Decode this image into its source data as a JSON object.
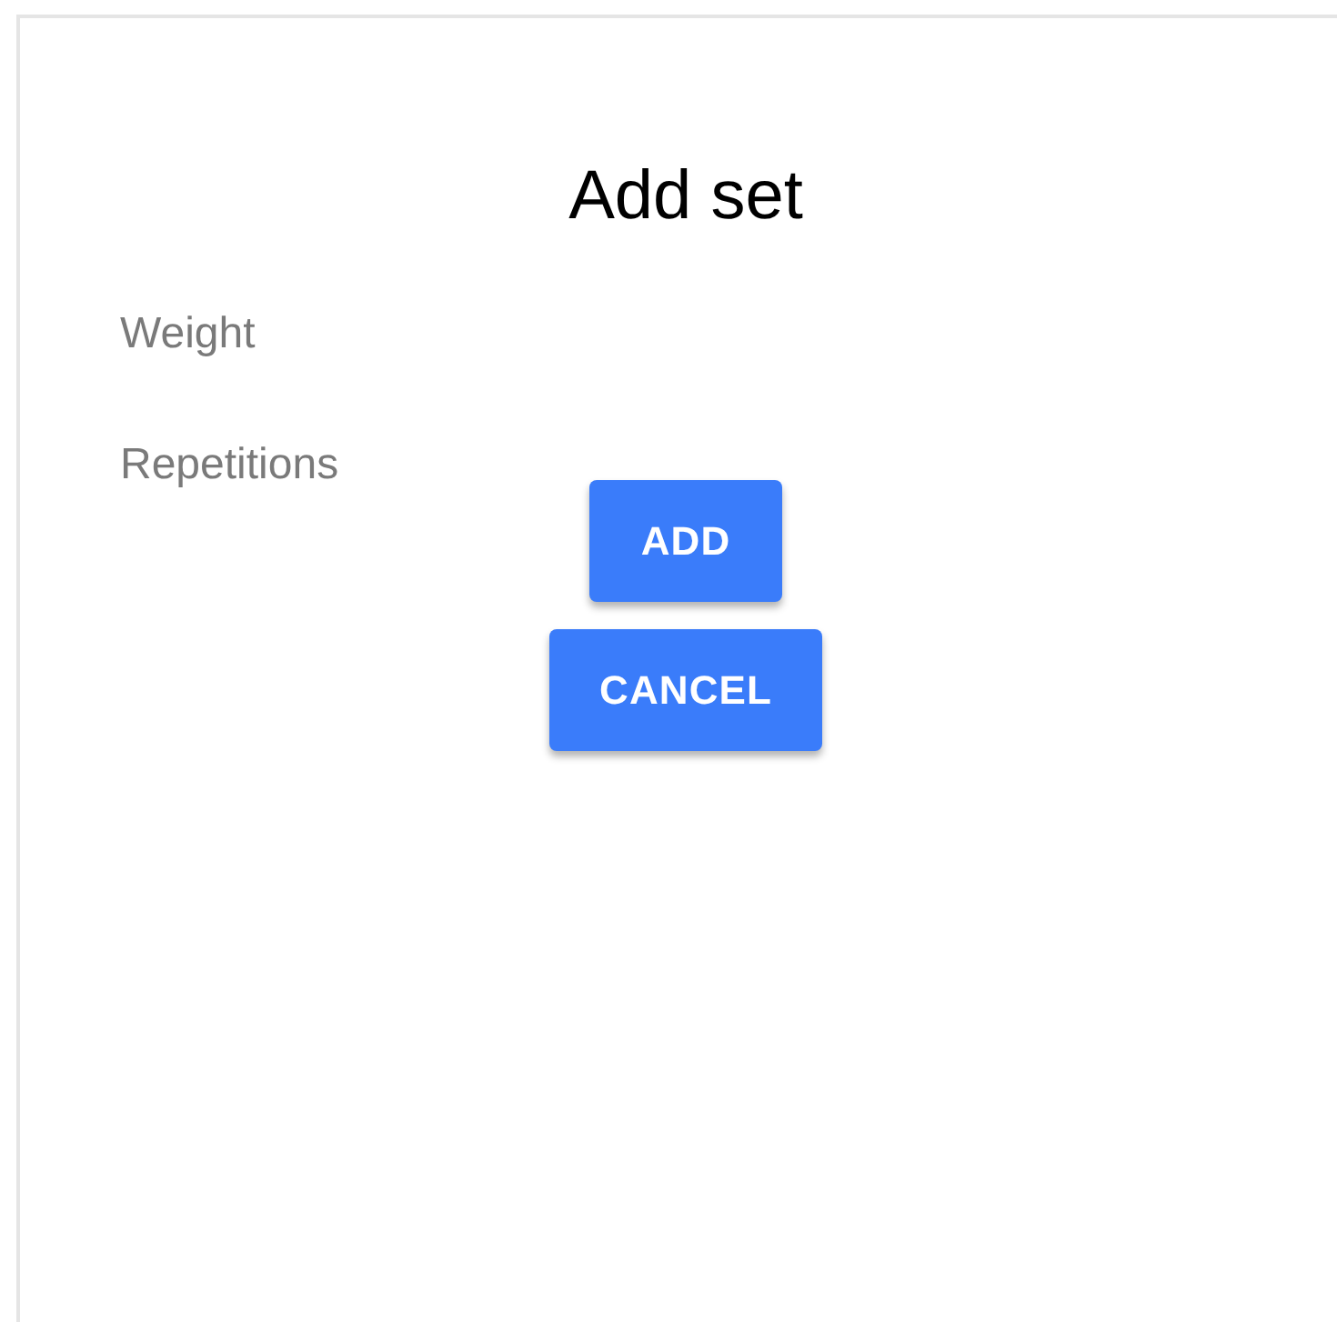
{
  "dialog": {
    "title": "Add set"
  },
  "fields": [
    {
      "placeholder": "Weight"
    },
    {
      "placeholder": "Repetitions"
    }
  ],
  "buttons": [
    "ADD",
    "CANCEL"
  ]
}
